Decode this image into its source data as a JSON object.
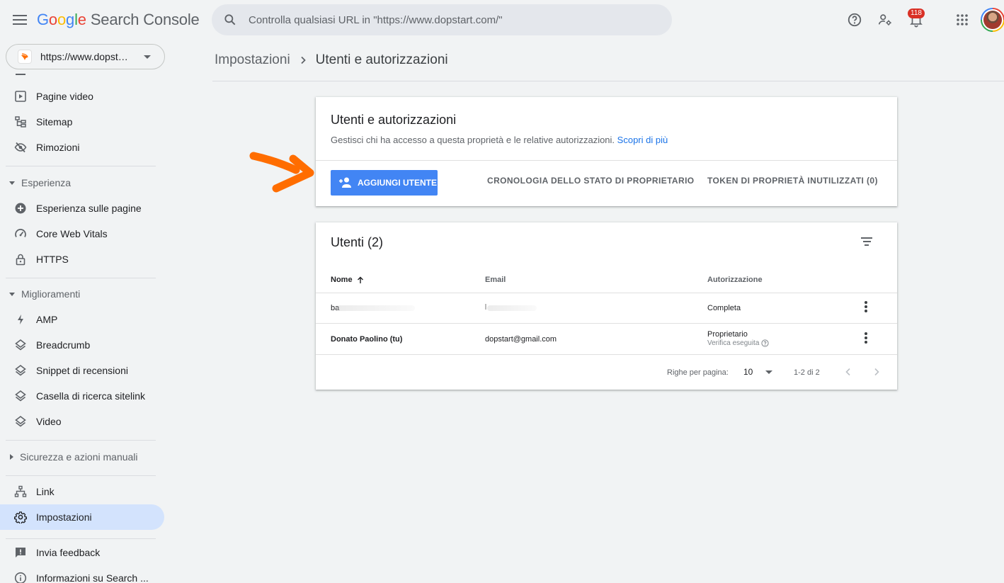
{
  "app": {
    "logo_google": [
      "G",
      "o",
      "o",
      "g",
      "l",
      "e"
    ],
    "logo_product": "Search Console",
    "notification_count": "118"
  },
  "search": {
    "placeholder": "Controlla qualsiasi URL in \"https://www.dopstart.com/\""
  },
  "property": {
    "url": "https://www.dopstart.com/"
  },
  "sidebar": {
    "items_top": [
      {
        "label": "Pagine video",
        "icon": "video-page-icon"
      },
      {
        "label": "Sitemap",
        "icon": "sitemap-icon"
      },
      {
        "label": "Rimozioni",
        "icon": "removals-icon"
      }
    ],
    "section_experience": "Esperienza",
    "items_experience": [
      {
        "label": "Esperienza sulle pagine",
        "icon": "page-experience-icon"
      },
      {
        "label": "Core Web Vitals",
        "icon": "gauge-icon"
      },
      {
        "label": "HTTPS",
        "icon": "lock-icon"
      }
    ],
    "section_enhancements": "Miglioramenti",
    "items_enhancements": [
      {
        "label": "AMP",
        "icon": "bolt-icon"
      },
      {
        "label": "Breadcrumb",
        "icon": "layers-icon"
      },
      {
        "label": "Snippet di recensioni",
        "icon": "layers-icon"
      },
      {
        "label": "Casella di ricerca sitelink",
        "icon": "layers-icon"
      },
      {
        "label": "Video",
        "icon": "layers-icon"
      }
    ],
    "section_security": "Sicurezza e azioni manuali",
    "items_bottom": [
      {
        "label": "Link",
        "icon": "links-icon"
      },
      {
        "label": "Impostazioni",
        "icon": "gear-icon"
      }
    ],
    "items_footer": [
      {
        "label": "Invia feedback",
        "icon": "feedback-icon"
      },
      {
        "label": "Informazioni su Search ...",
        "icon": "info-icon"
      }
    ]
  },
  "breadcrumb": {
    "parent": "Impostazioni",
    "current": "Utenti e autorizzazioni"
  },
  "permissions_card": {
    "title": "Utenti e autorizzazioni",
    "description": "Gestisci chi ha accesso a questa proprietà e le relative autorizzazioni.",
    "learn_more": "Scopri di più",
    "add_user_label": "AGGIUNGI UTENTE",
    "owner_history_label": "CRONOLOGIA DELLO STATO DI PROPRIETARIO",
    "unused_tokens_label": "TOKEN DI PROPRIETÀ INUTILIZZATI (0)"
  },
  "users_card": {
    "title": "Utenti (2)",
    "columns": {
      "name": "Nome",
      "email": "Email",
      "permission": "Autorizzazione"
    },
    "rows": [
      {
        "name": "ba",
        "email": "",
        "permission": "Completa",
        "sub": ""
      },
      {
        "name": "Donato Paolino (tu)",
        "email": "dopstart@gmail.com",
        "permission": "Proprietario",
        "sub": "Verifica eseguita"
      }
    ],
    "pagination": {
      "rows_per_page_label": "Righe per pagina:",
      "rows_per_page": "10",
      "range": "1-2 di 2"
    }
  },
  "colors": {
    "primary": "#4285f4",
    "active_nav": "#d3e3fd",
    "annotation_arrow": "#ff6d00",
    "badge": "#d93025"
  }
}
